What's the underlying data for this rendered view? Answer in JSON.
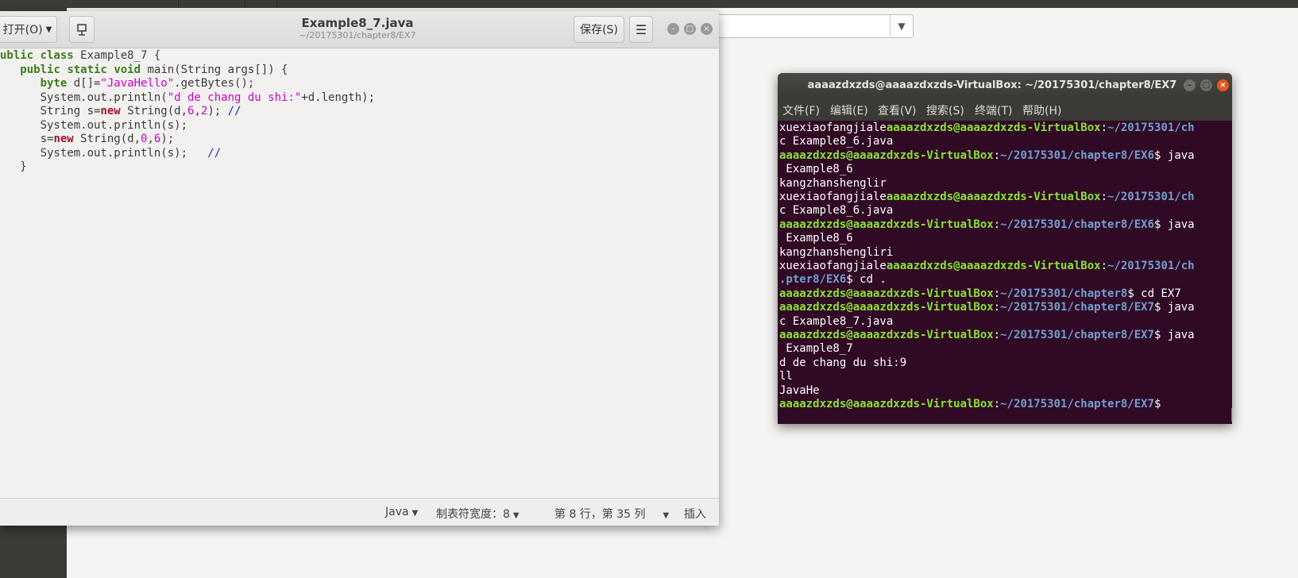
{
  "gedit": {
    "open_label": "打开(O)",
    "title": "Example8_7.java",
    "path": "~/20175301/chapter8/EX7",
    "save_label": "保存(S)",
    "menu_icon": "☰",
    "code": [
      [
        {
          "t": "ublic ",
          "c": "kw"
        },
        {
          "t": "class",
          "c": "kw"
        },
        {
          "t": " Example8_7 {",
          "c": ""
        }
      ],
      [
        {
          "t": "   ",
          "c": ""
        },
        {
          "t": "public",
          "c": "kw"
        },
        {
          "t": " ",
          "c": ""
        },
        {
          "t": "static",
          "c": "kw"
        },
        {
          "t": " ",
          "c": ""
        },
        {
          "t": "void",
          "c": "kw"
        },
        {
          "t": " main(String args[]) {",
          "c": ""
        }
      ],
      [
        {
          "t": "      ",
          "c": ""
        },
        {
          "t": "byte",
          "c": "kw"
        },
        {
          "t": " d[]=",
          "c": ""
        },
        {
          "t": "\"JavaHello\"",
          "c": "str"
        },
        {
          "t": ".getBytes();",
          "c": ""
        }
      ],
      [
        {
          "t": "      System.out.println(",
          "c": ""
        },
        {
          "t": "\"d de chang du shi:\"",
          "c": "str"
        },
        {
          "t": "+d.length);",
          "c": ""
        }
      ],
      [
        {
          "t": "      String s=",
          "c": ""
        },
        {
          "t": "new",
          "c": "kw2"
        },
        {
          "t": " String(d,",
          "c": ""
        },
        {
          "t": "6",
          "c": "num"
        },
        {
          "t": ",",
          "c": ""
        },
        {
          "t": "2",
          "c": "num"
        },
        {
          "t": "); ",
          "c": ""
        },
        {
          "t": "//",
          "c": "cmt"
        }
      ],
      [
        {
          "t": "      System.out.println(s);",
          "c": ""
        }
      ],
      [
        {
          "t": "      s=",
          "c": ""
        },
        {
          "t": "new",
          "c": "kw2"
        },
        {
          "t": " String(d,",
          "c": ""
        },
        {
          "t": "0",
          "c": "num"
        },
        {
          "t": ",",
          "c": ""
        },
        {
          "t": "6",
          "c": "num"
        },
        {
          "t": ");",
          "c": ""
        }
      ],
      [
        {
          "t": "      System.out.println(s);   ",
          "c": ""
        },
        {
          "t": "//",
          "c": "cmt"
        }
      ],
      [
        {
          "t": "   }",
          "c": ""
        }
      ]
    ],
    "status": {
      "language": "Java",
      "tab_width": "制表符宽度：8",
      "position": "第 8 行，第 35 列",
      "mode": "插入"
    }
  },
  "terminal": {
    "title": "aaaazdxzds@aaaazdxzds-VirtualBox: ~/20175301/chapter8/EX7",
    "menu": [
      "文件(F)",
      "编辑(E)",
      "查看(V)",
      "搜索(S)",
      "终端(T)",
      "帮助(H)"
    ],
    "lines": [
      [
        {
          "t": "xuexiaofangjiale",
          "c": ""
        },
        {
          "t": "aaaazdxzds@aaaazdxzds-VirtualBox",
          "c": "pu"
        },
        {
          "t": ":",
          "c": ""
        },
        {
          "t": "~/20175301/ch",
          "c": "pp"
        }
      ],
      [
        {
          "t": "c Example8_6.java",
          "c": ""
        }
      ],
      [
        {
          "t": "aaaazdxzds@aaaazdxzds-VirtualBox",
          "c": "pu"
        },
        {
          "t": ":",
          "c": ""
        },
        {
          "t": "~/20175301/chapter8/EX6",
          "c": "pp"
        },
        {
          "t": "$ java",
          "c": ""
        }
      ],
      [
        {
          "t": " Example8_6",
          "c": ""
        }
      ],
      [
        {
          "t": "kangzhanshenglir",
          "c": ""
        }
      ],
      [
        {
          "t": "xuexiaofangjiale",
          "c": ""
        },
        {
          "t": "aaaazdxzds@aaaazdxzds-VirtualBox",
          "c": "pu"
        },
        {
          "t": ":",
          "c": ""
        },
        {
          "t": "~/20175301/ch",
          "c": "pp"
        }
      ],
      [
        {
          "t": "c Example8_6.java",
          "c": ""
        }
      ],
      [
        {
          "t": "aaaazdxzds@aaaazdxzds-VirtualBox",
          "c": "pu"
        },
        {
          "t": ":",
          "c": ""
        },
        {
          "t": "~/20175301/chapter8/EX6",
          "c": "pp"
        },
        {
          "t": "$ java",
          "c": ""
        }
      ],
      [
        {
          "t": " Example8_6",
          "c": ""
        }
      ],
      [
        {
          "t": "kangzhanshengliri",
          "c": ""
        }
      ],
      [
        {
          "t": "xuexiaofangjiale",
          "c": ""
        },
        {
          "t": "aaaazdxzds@aaaazdxzds-VirtualBox",
          "c": "pu"
        },
        {
          "t": ":",
          "c": ""
        },
        {
          "t": "~/20175301/ch",
          "c": "pp"
        }
      ],
      [
        {
          "t": ".pter8/EX6",
          "c": "pp"
        },
        {
          "t": "$ cd .",
          "c": ""
        }
      ],
      [
        {
          "t": "aaaazdxzds@aaaazdxzds-VirtualBox",
          "c": "pu"
        },
        {
          "t": ":",
          "c": ""
        },
        {
          "t": "~/20175301/chapter8",
          "c": "pp"
        },
        {
          "t": "$ cd EX7",
          "c": ""
        }
      ],
      [
        {
          "t": "aaaazdxzds@aaaazdxzds-VirtualBox",
          "c": "pu"
        },
        {
          "t": ":",
          "c": ""
        },
        {
          "t": "~/20175301/chapter8/EX7",
          "c": "pp"
        },
        {
          "t": "$ java",
          "c": ""
        }
      ],
      [
        {
          "t": "c Example8_7.java",
          "c": ""
        }
      ],
      [
        {
          "t": "aaaazdxzds@aaaazdxzds-VirtualBox",
          "c": "pu"
        },
        {
          "t": ":",
          "c": ""
        },
        {
          "t": "~/20175301/chapter8/EX7",
          "c": "pp"
        },
        {
          "t": "$ java",
          "c": ""
        }
      ],
      [
        {
          "t": " Example8_7",
          "c": ""
        }
      ],
      [
        {
          "t": "d de chang du shi:9",
          "c": ""
        }
      ],
      [
        {
          "t": "ll",
          "c": ""
        }
      ],
      [
        {
          "t": "JavaHe",
          "c": ""
        }
      ],
      [
        {
          "t": "aaaazdxzds@aaaazdxzds-VirtualBox",
          "c": "pu"
        },
        {
          "t": ":",
          "c": ""
        },
        {
          "t": "~/20175301/chapter8/EX7",
          "c": "pp"
        },
        {
          "t": "$",
          "c": ""
        }
      ]
    ]
  }
}
